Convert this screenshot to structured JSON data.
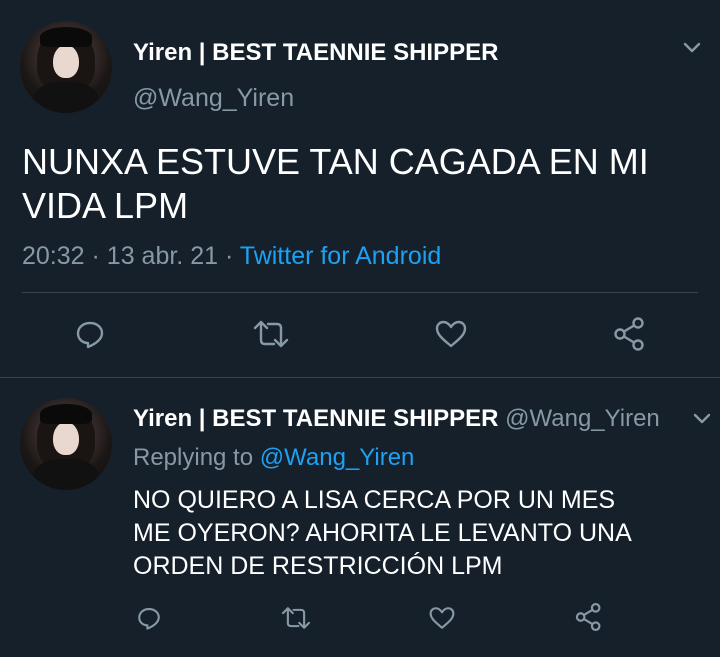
{
  "main_tweet": {
    "display_name": "Yiren | BEST TAENNIE SHIPPER",
    "handle": "@Wang_Yiren",
    "text_line1": "NUNXA ESTUVE TAN CAGADA EN MI",
    "text_line2": "VIDA LPM",
    "time": "20:32",
    "sep1": "·",
    "date": "13 abr. 21",
    "sep2": "·",
    "source": "Twitter for Android"
  },
  "reply_tweet": {
    "display_name": "Yiren | BEST TAENNIE SHIPPER",
    "handle": "@Wang_Yiren",
    "replying_to_label": "Replying to",
    "replying_to_handle": "@Wang_Yiren",
    "text_line1": "NO QUIERO A LISA CERCA POR UN MES",
    "text_line2": "ME OYERON? AHORITA LE LEVANTO UNA",
    "text_line3": "ORDEN DE RESTRICCIÓN LPM"
  },
  "icons": {
    "reply": "comment-icon",
    "retweet": "retweet-icon",
    "like": "heart-icon",
    "share": "share-icon",
    "menu": "chevron-down-icon"
  },
  "colors": {
    "background": "#15202b",
    "primary_text": "#ffffff",
    "secondary_text": "#8899a6",
    "accent": "#1da1f2",
    "divider": "#38444d"
  }
}
